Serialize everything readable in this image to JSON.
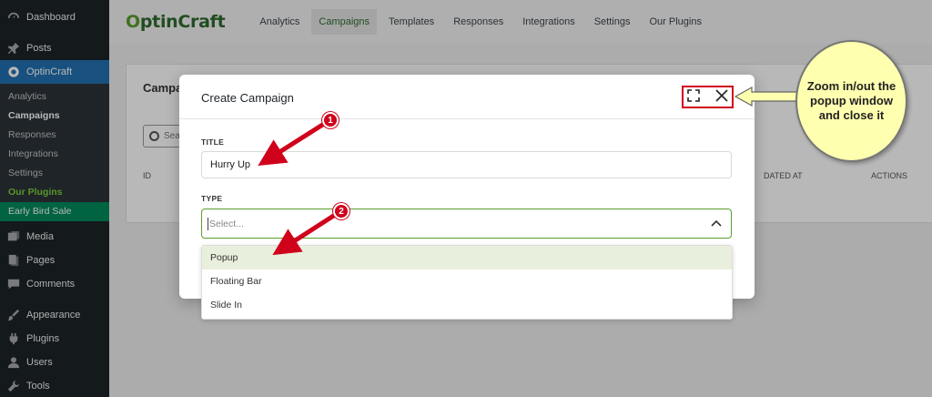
{
  "sidebar": {
    "top_items": [
      {
        "label": "Dashboard",
        "icon": "dashboard-icon"
      },
      {
        "label": "Posts",
        "icon": "pin-icon"
      },
      {
        "label": "OptinCraft",
        "icon": "optincraft-icon"
      }
    ],
    "submenu": [
      "Analytics",
      "Campaigns",
      "Responses",
      "Integrations",
      "Settings",
      "Our Plugins",
      "Early Bird Sale"
    ],
    "bottom_items": [
      {
        "label": "Media",
        "icon": "media-icon"
      },
      {
        "label": "Pages",
        "icon": "pages-icon"
      },
      {
        "label": "Comments",
        "icon": "comments-icon"
      },
      {
        "label": "Appearance",
        "icon": "appearance-icon"
      },
      {
        "label": "Plugins",
        "icon": "plugins-icon"
      },
      {
        "label": "Users",
        "icon": "users-icon"
      },
      {
        "label": "Tools",
        "icon": "tools-icon"
      }
    ]
  },
  "header": {
    "logo_first": "O",
    "logo_rest": "ptinCraft",
    "tabs": [
      "Analytics",
      "Campaigns",
      "Templates",
      "Responses",
      "Integrations",
      "Settings",
      "Our Plugins"
    ],
    "active_tab": "Campaigns"
  },
  "background_card": {
    "title": "Campai",
    "search_text": "Sear",
    "col_id": "ID",
    "col_updated": "DATED AT",
    "col_actions": "ACTIONS"
  },
  "modal": {
    "title": "Create Campaign",
    "title_label": "TITLE",
    "title_value": "Hurry Up",
    "type_label": "TYPE",
    "type_placeholder": "Select...",
    "options": [
      "Popup",
      "Floating Bar",
      "Slide In"
    ],
    "highlighted_option": "Popup"
  },
  "annotations": {
    "bubble_text": "Zoom in/out the popup window and close it",
    "badge_1": "1",
    "badge_2": "2",
    "accent_color": "#d0021b"
  },
  "colors": {
    "sidebar_bg": "#1d2327",
    "active_menu": "#2271b1",
    "brand_green": "#5a9e2c",
    "sale_bg": "#008a5c"
  }
}
